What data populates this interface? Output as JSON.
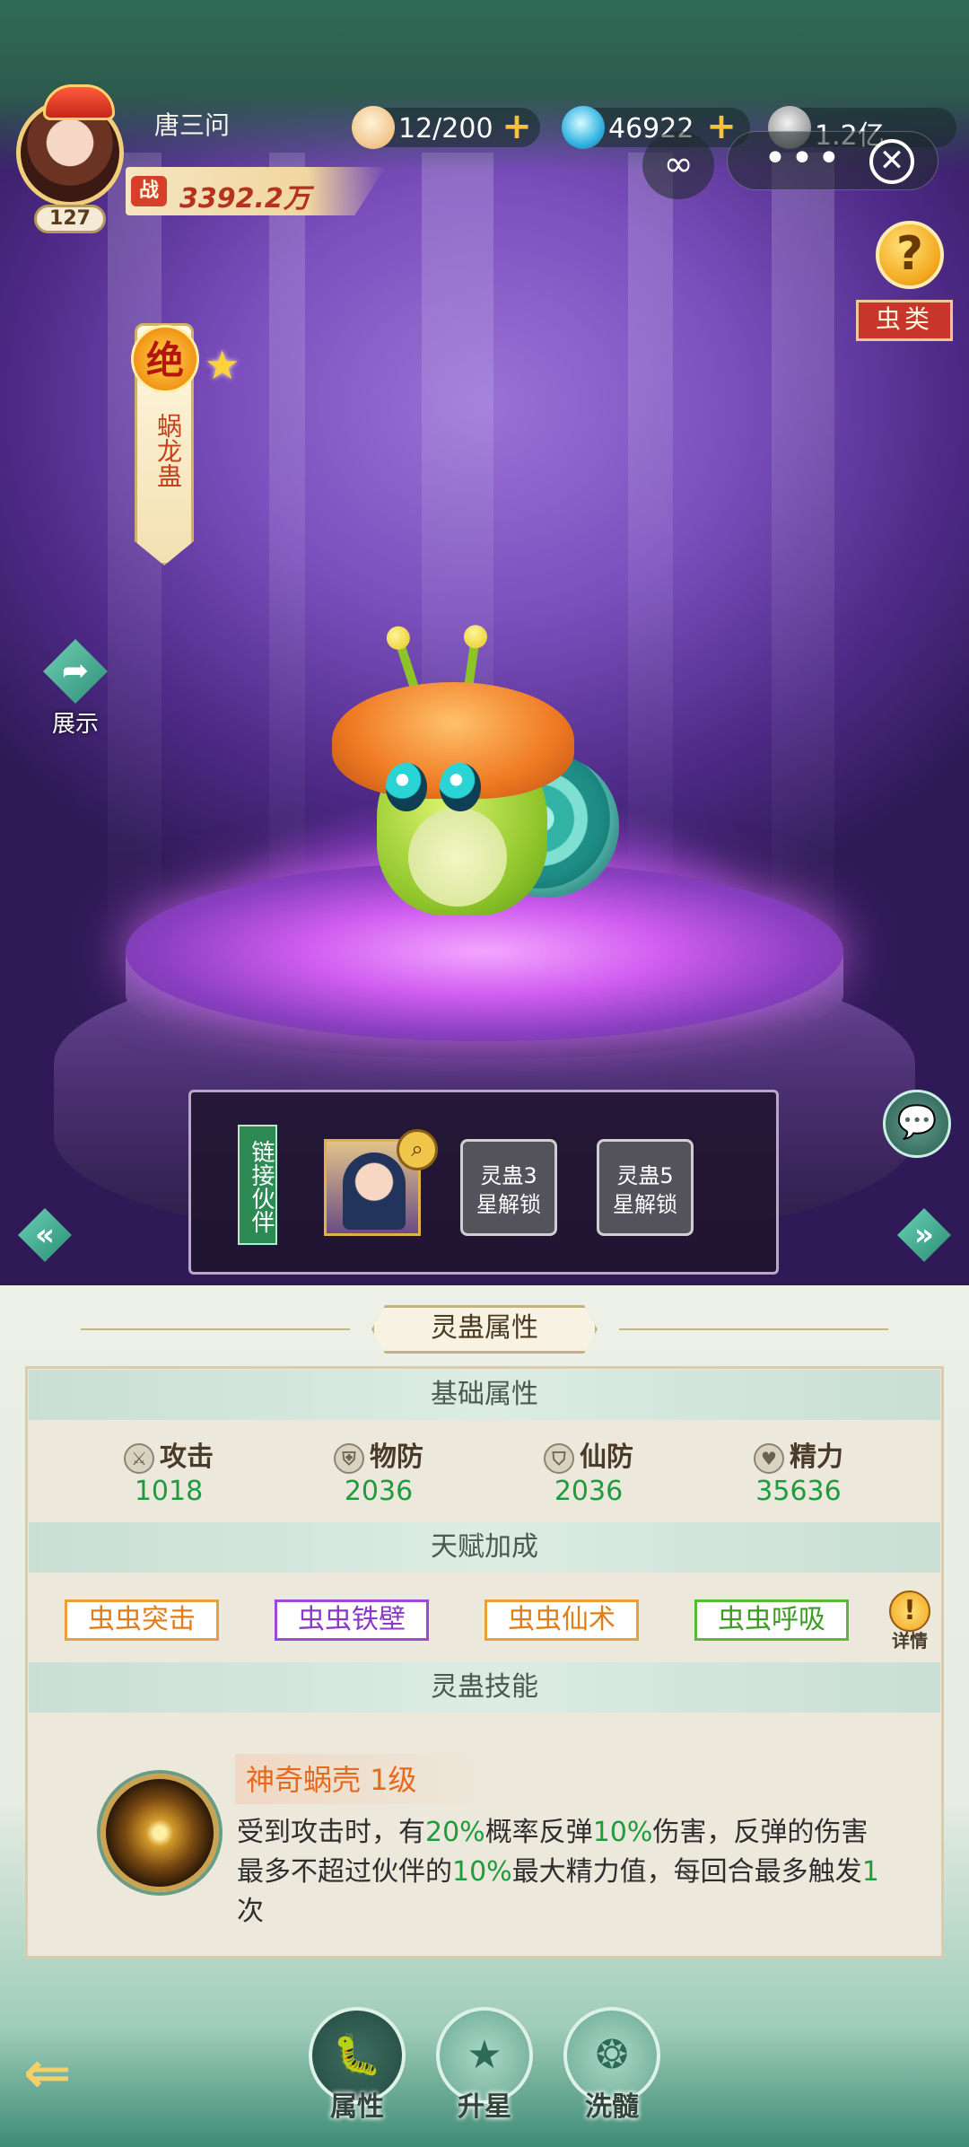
{
  "player": {
    "name": "唐三问",
    "level": "127",
    "power_label": "战",
    "power": "3392.2万"
  },
  "resources": {
    "bun": "12/200",
    "gems": "46922",
    "coins": "1.2亿"
  },
  "top_right": {
    "help": "?",
    "category": "虫类",
    "close": "✕",
    "dots": "•••"
  },
  "pet": {
    "rank": "绝",
    "name": "蜗龙蛊",
    "stars": "★"
  },
  "show": {
    "label": "展示"
  },
  "partner": {
    "label": "链接伙伴",
    "slot2": "灵蛊3\n星解锁",
    "slot2_line1": "灵蛊3",
    "slot2_line2": "星解锁",
    "slot3_line1": "灵蛊5",
    "slot3_line2": "星解锁"
  },
  "panel": {
    "title": "灵蛊属性",
    "basic_header": "基础属性",
    "stats": [
      {
        "label": "攻击",
        "value": "1018"
      },
      {
        "label": "物防",
        "value": "2036"
      },
      {
        "label": "仙防",
        "value": "2036"
      },
      {
        "label": "精力",
        "value": "35636"
      }
    ],
    "talent_header": "天赋加成",
    "talents": [
      {
        "label": "虫虫突击",
        "color": "#e8a13a"
      },
      {
        "label": "虫虫铁壁",
        "color": "#9b4ad8"
      },
      {
        "label": "虫虫仙术",
        "color": "#e8a13a"
      },
      {
        "label": "虫虫呼吸",
        "color": "#5bb83a"
      }
    ],
    "talent_detail": "详情",
    "skill_header": "灵蛊技能",
    "skill": {
      "name": "神奇蜗壳 1级",
      "desc_1": "受到攻击时，有",
      "pct_1": "20%",
      "desc_2": "概率反弹",
      "pct_2": "10%",
      "desc_3": "伤害，反弹的伤害最多不超过伙伴的",
      "pct_3": "10%",
      "desc_4": "最大精力值，每回合最多触发",
      "count": "1",
      "desc_5": "次"
    }
  },
  "nav": [
    {
      "label": "属性",
      "active": true
    },
    {
      "label": "升星",
      "active": false
    },
    {
      "label": "洗髓",
      "active": false
    }
  ]
}
